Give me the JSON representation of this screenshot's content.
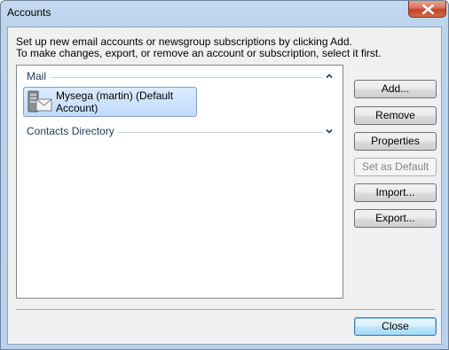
{
  "window": {
    "title": "Accounts"
  },
  "instructions": {
    "line1": "Set up new email accounts or newsgroup subscriptions by clicking Add.",
    "line2": "To make changes, export, or remove an account or subscription, select it first."
  },
  "groups": {
    "mail": {
      "label": "Mail",
      "state": "expanded",
      "accounts": [
        {
          "name": "Mysega (martin) (Default Account)",
          "selected": true
        }
      ]
    },
    "contacts": {
      "label": "Contacts Directory",
      "state": "collapsed"
    }
  },
  "buttons": {
    "add": "Add...",
    "remove": "Remove",
    "properties": "Properties",
    "set_default": "Set as Default",
    "import": "Import...",
    "export": "Export...",
    "close": "Close"
  },
  "icons": {
    "close_window": "close-x-icon",
    "mail_collapse": "chevron-up-icon",
    "contacts_expand": "chevron-down-icon",
    "account": "mail-server-icon"
  },
  "colors": {
    "group_header_text": "#1e395b",
    "selection_border": "#7da2ce",
    "selection_fill": "#c1dbfc",
    "title_close_button": "#c4442a"
  }
}
